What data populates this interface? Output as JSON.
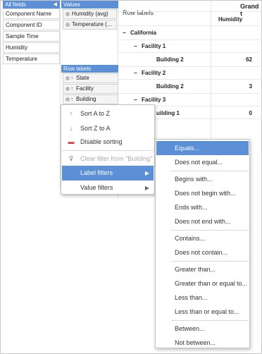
{
  "fields_panel": {
    "all_fields_header": "All fields",
    "values_header": "Values",
    "row_labels_header": "Row labels",
    "all_fields": [
      "Component Name",
      "Component ID",
      "Sample Time",
      "Humidity",
      "Temperature"
    ],
    "values": [
      "Humidity (avg)",
      "Temperature (..."
    ],
    "row_labels": [
      "State",
      "Facility",
      "Building"
    ]
  },
  "pivot": {
    "row_labels_title": "Row labels",
    "grand_header": "Grand t",
    "humidity_header": "Humidity",
    "rows": [
      {
        "label": "California",
        "toggle": "−",
        "value": ""
      },
      {
        "label": "Facility 1",
        "toggle": "−",
        "value": ""
      },
      {
        "label": "Building 2",
        "toggle": "",
        "value": "62"
      },
      {
        "label": "Facility 2",
        "toggle": "−",
        "value": ""
      },
      {
        "label": "Building 2",
        "toggle": "",
        "value": "3"
      },
      {
        "label": "Facility 3",
        "toggle": "−",
        "value": ""
      },
      {
        "label": "uilding 1",
        "toggle": "",
        "value": "0"
      }
    ]
  },
  "context_menu": {
    "sort_a_z": "Sort A to Z",
    "sort_z_a": "Sort Z to A",
    "disable_sorting": "Disable sorting",
    "clear_filter": "Clear filter from \"Building\"",
    "label_filters": "Label filters",
    "value_filters": "Value filters"
  },
  "label_filters_menu": {
    "items": [
      "Equals...",
      "Does not equal...",
      "Begins with...",
      "Does not begin with...",
      "Ends with...",
      "Does not end with...",
      "Contains...",
      "Does not contain...",
      "Greater than...",
      "Greater than or equal to...",
      "Less than...",
      "Less than or equal to...",
      "Between...",
      "Not between..."
    ]
  },
  "colors": {
    "accent": "#5b8fd6",
    "border": "#c4c4c4"
  }
}
